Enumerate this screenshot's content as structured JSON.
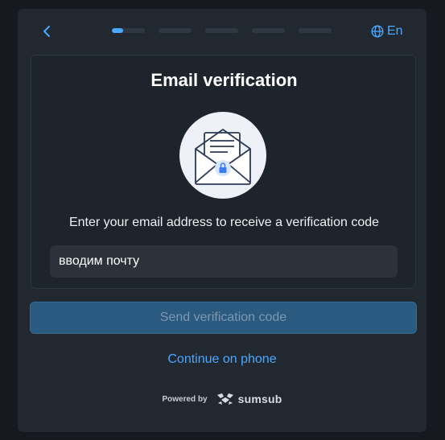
{
  "header": {
    "back_icon": "chevron-left-icon",
    "progress": {
      "total_steps": 5,
      "current_step": 1,
      "current_step_fill": 0.35
    },
    "language": {
      "icon": "globe-icon",
      "label": "En"
    }
  },
  "main": {
    "title": "Email verification",
    "illustration_icon": "envelope-lock-icon",
    "description": "Enter your email address to receive a verification code",
    "email_input": {
      "value": "вводим почту",
      "placeholder": ""
    }
  },
  "actions": {
    "send_label": "Send verification code",
    "phone_link_label": "Continue on phone"
  },
  "footer": {
    "powered_by": "Powered by",
    "brand_name": "sumsub",
    "brand_icon": "sumsub-logo-icon"
  },
  "colors": {
    "background": "#161a20",
    "panel": "#212830",
    "card": "#1d242c",
    "accent": "#4aa8ff",
    "button_disabled": "#2a5a80",
    "button_text_disabled": "#7d97ae"
  }
}
